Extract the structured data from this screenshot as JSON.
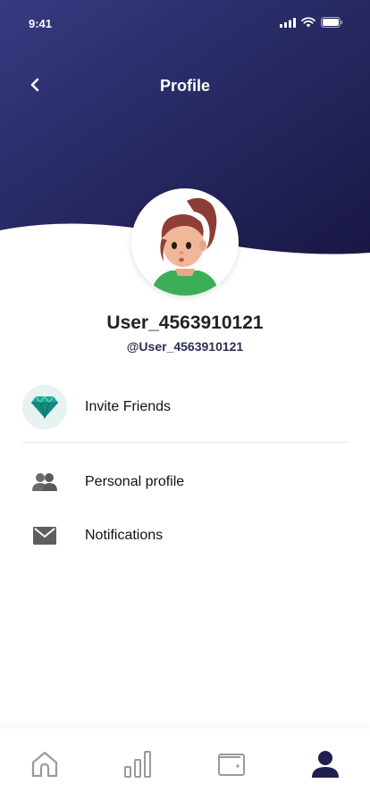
{
  "status_bar": {
    "time": "9:41"
  },
  "header": {
    "title": "Profile",
    "back_icon": "chevron-left-icon"
  },
  "colors": {
    "header_top": "#34387d",
    "header_bottom": "#1b1a4d",
    "accent": "#1f2050"
  },
  "user": {
    "display_name": "User_4563910121",
    "handle": "@User_4563910121"
  },
  "menu": {
    "items": [
      {
        "label": "Invite Friends",
        "icon": "diamond-icon"
      },
      {
        "label": "Personal profile",
        "icon": "users-icon"
      },
      {
        "label": "Notifications",
        "icon": "mail-icon"
      }
    ]
  },
  "tabbar": {
    "tabs": [
      {
        "icon": "home-icon",
        "active": false
      },
      {
        "icon": "bar-chart-icon",
        "active": false
      },
      {
        "icon": "wallet-icon",
        "active": false
      },
      {
        "icon": "user-icon",
        "active": true
      }
    ]
  }
}
